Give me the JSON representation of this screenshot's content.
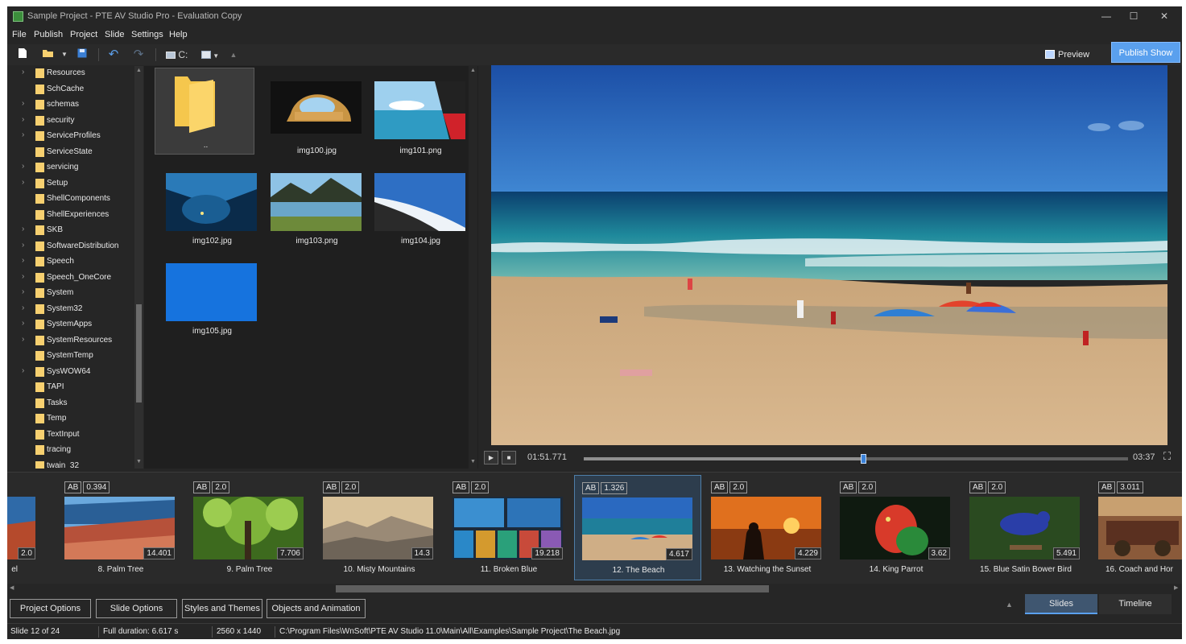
{
  "window": {
    "title": "Sample Project - PTE AV Studio Pro - Evaluation Copy"
  },
  "menu": [
    "File",
    "Publish",
    "Project",
    "Slide",
    "Settings",
    "Help"
  ],
  "toolbar": {
    "icons": [
      "new-document",
      "open-folder",
      "dropdown",
      "save",
      "undo",
      "redo",
      "drive",
      "view-mode",
      "scroll-up"
    ],
    "drive_label": "C:",
    "preview_label": "Preview",
    "publish_label": "Publish Show"
  },
  "tree": {
    "items": [
      {
        "label": "Resources",
        "expandable": true
      },
      {
        "label": "SchCache",
        "expandable": false
      },
      {
        "label": "schemas",
        "expandable": true
      },
      {
        "label": "security",
        "expandable": true
      },
      {
        "label": "ServiceProfiles",
        "expandable": true
      },
      {
        "label": "ServiceState",
        "expandable": false
      },
      {
        "label": "servicing",
        "expandable": true
      },
      {
        "label": "Setup",
        "expandable": true
      },
      {
        "label": "ShellComponents",
        "expandable": false
      },
      {
        "label": "ShellExperiences",
        "expandable": false
      },
      {
        "label": "SKB",
        "expandable": true
      },
      {
        "label": "SoftwareDistribution",
        "expandable": true
      },
      {
        "label": "Speech",
        "expandable": true
      },
      {
        "label": "Speech_OneCore",
        "expandable": true
      },
      {
        "label": "System",
        "expandable": true
      },
      {
        "label": "System32",
        "expandable": true
      },
      {
        "label": "SystemApps",
        "expandable": true
      },
      {
        "label": "SystemResources",
        "expandable": true
      },
      {
        "label": "SystemTemp",
        "expandable": false
      },
      {
        "label": "SysWOW64",
        "expandable": true
      },
      {
        "label": "TAPI",
        "expandable": false
      },
      {
        "label": "Tasks",
        "expandable": false
      },
      {
        "label": "Temp",
        "expandable": false
      },
      {
        "label": "TextInput",
        "expandable": false
      },
      {
        "label": "tracing",
        "expandable": false
      },
      {
        "label": "twain_32",
        "expandable": false
      }
    ]
  },
  "files": [
    {
      "name": "..",
      "kind": "parent-folder"
    },
    {
      "name": "img100.jpg",
      "kind": "image"
    },
    {
      "name": "img101.png",
      "kind": "image"
    },
    {
      "name": "img102.jpg",
      "kind": "image"
    },
    {
      "name": "img103.png",
      "kind": "image"
    },
    {
      "name": "img104.jpg",
      "kind": "image"
    },
    {
      "name": "img105.jpg",
      "kind": "image"
    }
  ],
  "player": {
    "current_time": "01:51.771",
    "total_time": "03:37",
    "progress": 0.513
  },
  "slides": [
    {
      "title": "el",
      "duration": "2.0",
      "ab": "",
      "transition": "",
      "selected": false
    },
    {
      "title": "8. Palm Tree",
      "duration": "14.401",
      "ab": "AB",
      "transition": "0.394",
      "selected": false
    },
    {
      "title": "9. Palm Tree",
      "duration": "7.706",
      "ab": "AB",
      "transition": "2.0",
      "selected": false
    },
    {
      "title": "10. Misty Mountains",
      "duration": "14.3",
      "ab": "AB",
      "transition": "2.0",
      "selected": false
    },
    {
      "title": "11. Broken Blue",
      "duration": "19.218",
      "ab": "AB",
      "transition": "2.0",
      "selected": false
    },
    {
      "title": "12. The Beach",
      "duration": "4.617",
      "ab": "AB",
      "transition": "1.326",
      "selected": true
    },
    {
      "title": "13. Watching the Sunset",
      "duration": "4.229",
      "ab": "AB",
      "transition": "2.0",
      "selected": false
    },
    {
      "title": "14. King Parrot",
      "duration": "3.62",
      "ab": "AB",
      "transition": "2.0",
      "selected": false
    },
    {
      "title": "15. Blue Satin Bower Bird",
      "duration": "5.491",
      "ab": "AB",
      "transition": "2.0",
      "selected": false
    },
    {
      "title": "16. Coach and Hor",
      "duration": "",
      "ab": "AB",
      "transition": "3.011",
      "selected": false
    }
  ],
  "bottom_buttons": [
    "Project Options",
    "Slide Options",
    "Styles and Themes",
    "Objects and Animation"
  ],
  "mode_tabs": {
    "slides": "Slides",
    "timeline": "Timeline",
    "active": "slides"
  },
  "status": {
    "slide": "Slide 12 of 24",
    "duration": "Full duration: 6.617 s",
    "resolution": "2560 x 1440",
    "path": "C:\\Program Files\\WnSoft\\PTE AV Studio 11.0\\Main\\All\\Examples\\Sample Project\\The Beach.jpg"
  },
  "colors": {
    "accent": "#5aa0ee",
    "panel": "#262626",
    "selected_slide": "#2d3d4d",
    "folder": "#f7d070"
  }
}
